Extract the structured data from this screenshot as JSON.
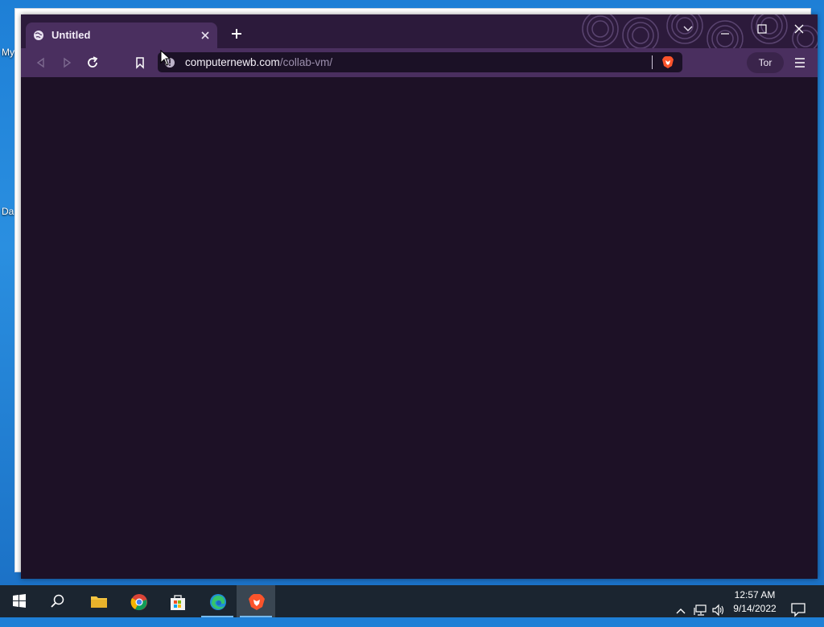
{
  "desktop": {
    "icon_labels": [
      "My",
      "Da"
    ]
  },
  "browser": {
    "tab": {
      "title": "Untitled"
    },
    "url": {
      "host": "computernewb.com",
      "path": "/collab-vm/"
    },
    "tor_label": "Tor",
    "colors": {
      "accent": "#4a2f5f",
      "content_bg": "#1d1126",
      "titlebar_bg": "#2c1a3b",
      "shield": "#fb542b"
    },
    "icons": {
      "tab": "globe-icon",
      "close": "close-icon",
      "new_tab": "plus-icon",
      "back": "back-icon",
      "forward": "forward-icon",
      "reload": "reload-icon",
      "bookmark": "bookmark-icon",
      "site_info": "info-icon",
      "shields": "brave-shield-icon",
      "menu": "hamburger-menu-icon"
    }
  },
  "taskbar": {
    "clock_time": "12:57 AM",
    "clock_date": "9/14/2022",
    "apps": [
      "start-icon",
      "search-icon",
      "file-explorer-icon",
      "chrome-icon",
      "store-icon",
      "edge-icon",
      "brave-icon"
    ]
  }
}
